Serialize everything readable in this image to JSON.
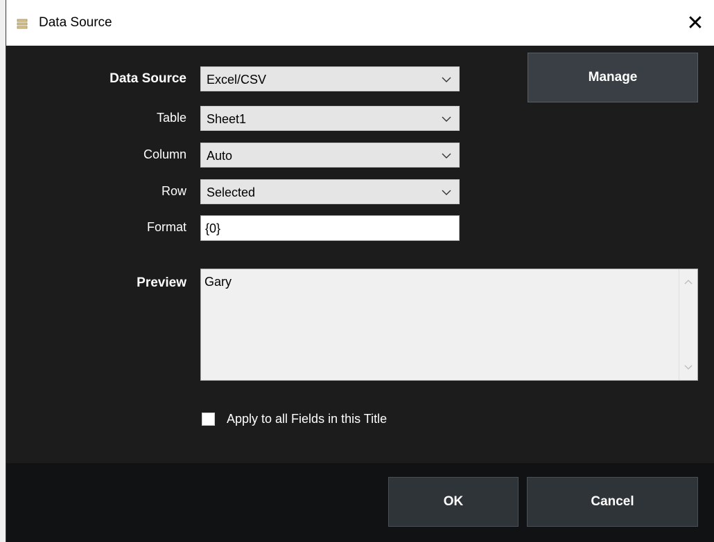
{
  "window": {
    "title": "Data Source",
    "icon": "database-icon",
    "close_glyph": "✕"
  },
  "form": {
    "data_source": {
      "label": "Data Source",
      "value": "Excel/CSV"
    },
    "table": {
      "label": "Table",
      "value": "Sheet1"
    },
    "column": {
      "label": "Column",
      "value": "Auto"
    },
    "row": {
      "label": "Row",
      "value": "Selected"
    },
    "format": {
      "label": "Format",
      "value": "{0}"
    },
    "manage_label": "Manage",
    "preview": {
      "label": "Preview",
      "value": "Gary"
    },
    "apply_all": {
      "label": "Apply to all Fields in this Title",
      "checked": false
    }
  },
  "footer": {
    "ok_label": "OK",
    "cancel_label": "Cancel"
  },
  "colors": {
    "background": "#1c1c1c",
    "footer": "#111214",
    "button": "#3a3f45"
  }
}
